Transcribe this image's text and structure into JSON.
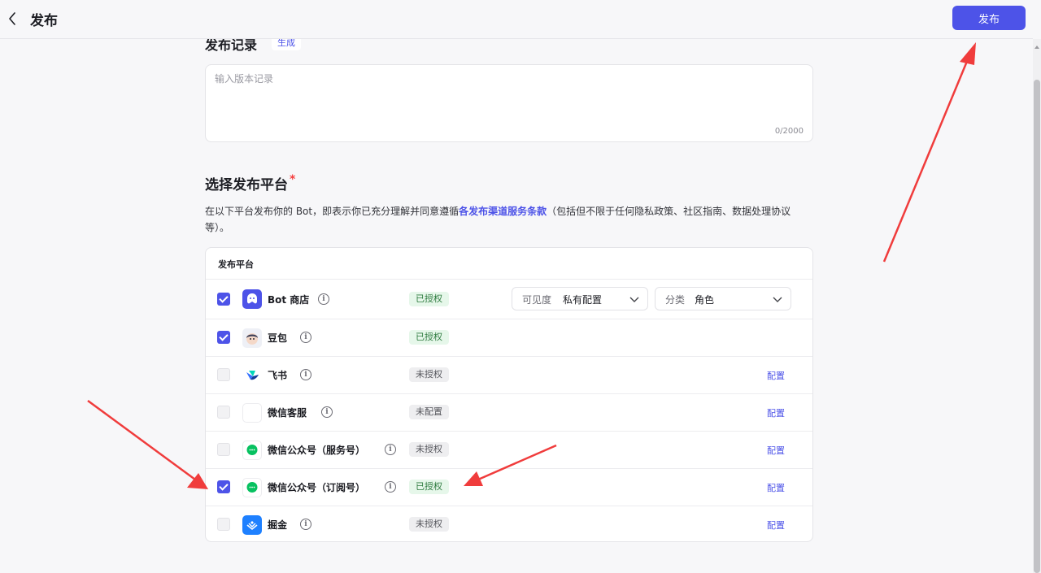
{
  "header": {
    "title": "发布",
    "publish_label": "发布"
  },
  "notes": {
    "title": "发布记录",
    "generate_label": "生成",
    "placeholder": "输入版本记录",
    "counter": "0/2000"
  },
  "platforms_section": {
    "title": "选择发布平台",
    "required_mark": "*",
    "desc_before": "在以下平台发布你的 Bot，即表示你已充分理解并同意遵循",
    "desc_link": "各发布渠道服务条款",
    "desc_after": "（包括但不限于任何隐私政策、社区指南、数据处理协议等）。",
    "table_header": "发布平台"
  },
  "bot_store": {
    "visibility_label": "可见度",
    "visibility_value": "私有配置",
    "category_label": "分类",
    "category_value": "角色"
  },
  "platforms": [
    {
      "name": "Bot 商店",
      "checked": true,
      "status": "已授权",
      "status_type": "ok",
      "icon": "bot-store-icon"
    },
    {
      "name": "豆包",
      "checked": true,
      "status": "已授权",
      "status_type": "ok",
      "icon": "doubao-icon"
    },
    {
      "name": "飞书",
      "checked": false,
      "status": "未授权",
      "status_type": "no",
      "icon": "feishu-icon",
      "config": "配置"
    },
    {
      "name": "微信客服",
      "checked": false,
      "status": "未配置",
      "status_type": "no",
      "icon": "wechat-service-icon",
      "config": "配置"
    },
    {
      "name": "微信公众号（服务号）",
      "checked": false,
      "status": "未授权",
      "status_type": "no",
      "icon": "wechat-icon",
      "config": "配置"
    },
    {
      "name": "微信公众号（订阅号）",
      "checked": true,
      "status": "已授权",
      "status_type": "ok",
      "icon": "wechat-icon",
      "config": "配置"
    },
    {
      "name": "掘金",
      "checked": false,
      "status": "未授权",
      "status_type": "no",
      "icon": "juejin-icon",
      "config": "配置"
    }
  ],
  "colors": {
    "accent": "#4d53e8",
    "ok_bg": "#e6f7ea",
    "ok_text": "#2d7a3e",
    "arrow": "#f03c3c"
  }
}
